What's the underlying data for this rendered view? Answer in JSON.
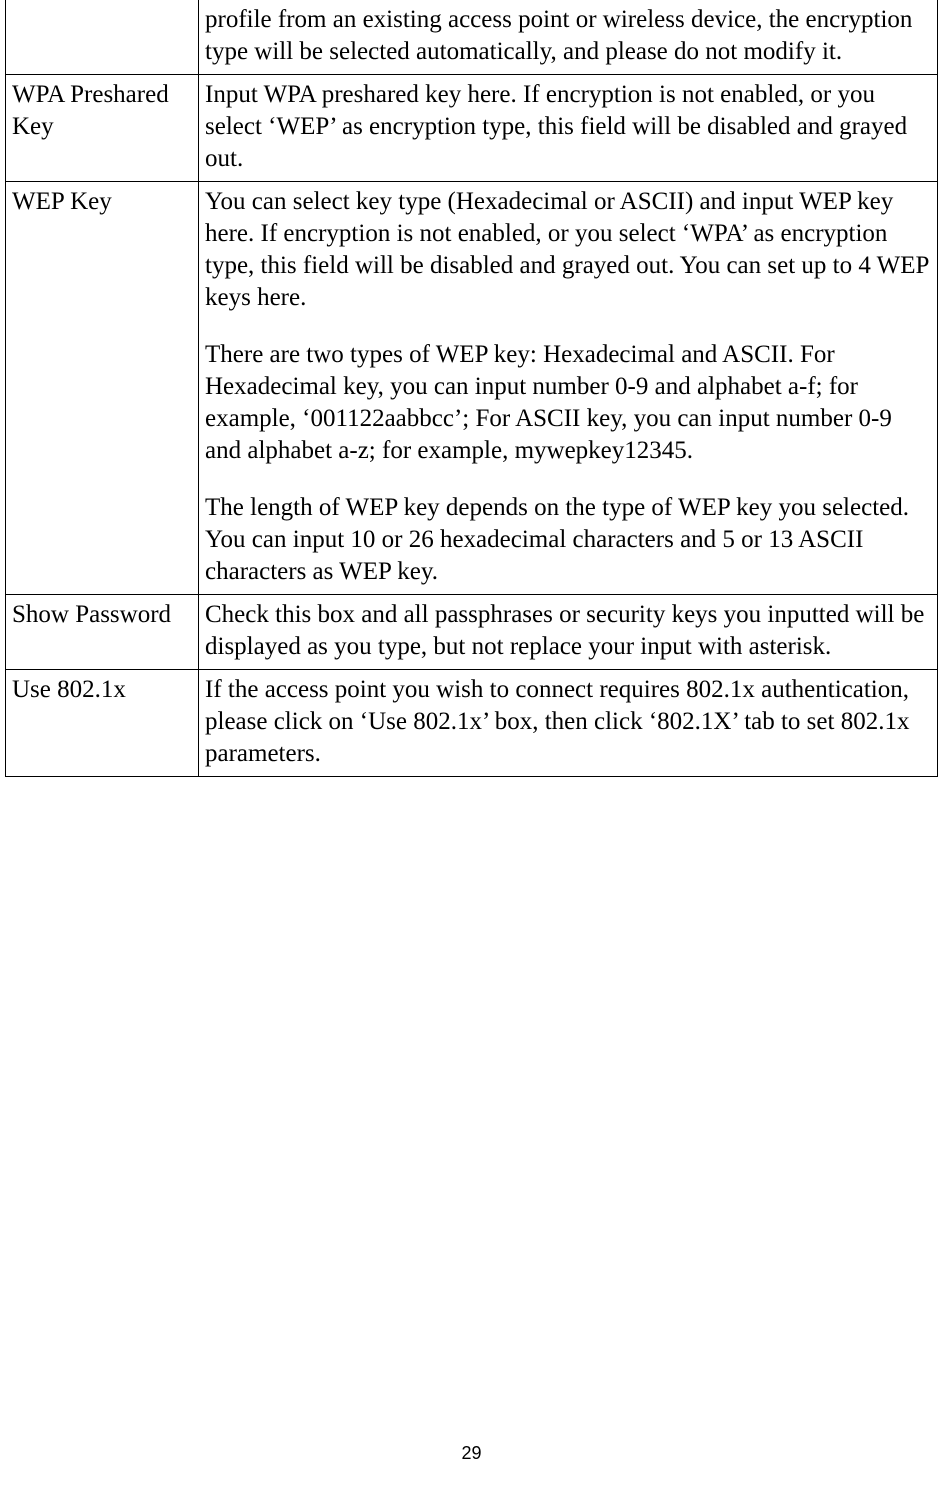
{
  "page_number": "29",
  "rows": {
    "continuation": {
      "term": "",
      "desc": "profile from an existing access point or wireless device, the encryption type will be selected automatically, and please do not modify it."
    },
    "wpa": {
      "term": "WPA Preshared Key",
      "desc": "Input WPA preshared key here. If encryption is not enabled, or you select ‘WEP’ as encryption type, this field will be disabled and grayed out."
    },
    "wep": {
      "term": "WEP Key",
      "desc_p1": "You can select key type (Hexadecimal or ASCII) and input WEP key here. If encryption is not enabled, or you select ‘WPA’ as encryption type, this field will be disabled and grayed out. You can set up to 4 WEP keys here.",
      "desc_p2": "There are two types of WEP key: Hexadecimal and ASCII. For Hexadecimal key, you can input number 0-9 and alphabet a-f; for example, ‘001122aabbcc’; For ASCII key, you can input number 0-9 and alphabet a-z; for example, mywepkey12345.",
      "desc_p3": "The length of WEP key depends on the type of WEP key you selected. You can input 10 or 26 hexadecimal characters and 5 or 13 ASCII characters as WEP key."
    },
    "show_password": {
      "term": "Show Password",
      "desc": "Check this box and all passphrases or security keys you inputted will be displayed as you type, but not replace your input with asterisk."
    },
    "use_8021x": {
      "term": "Use 802.1x",
      "desc": "If the access point you wish to connect requires 802.1x authentication, please click on ‘Use 802.1x’ box, then click ‘802.1X’ tab to set 802.1x parameters."
    }
  }
}
